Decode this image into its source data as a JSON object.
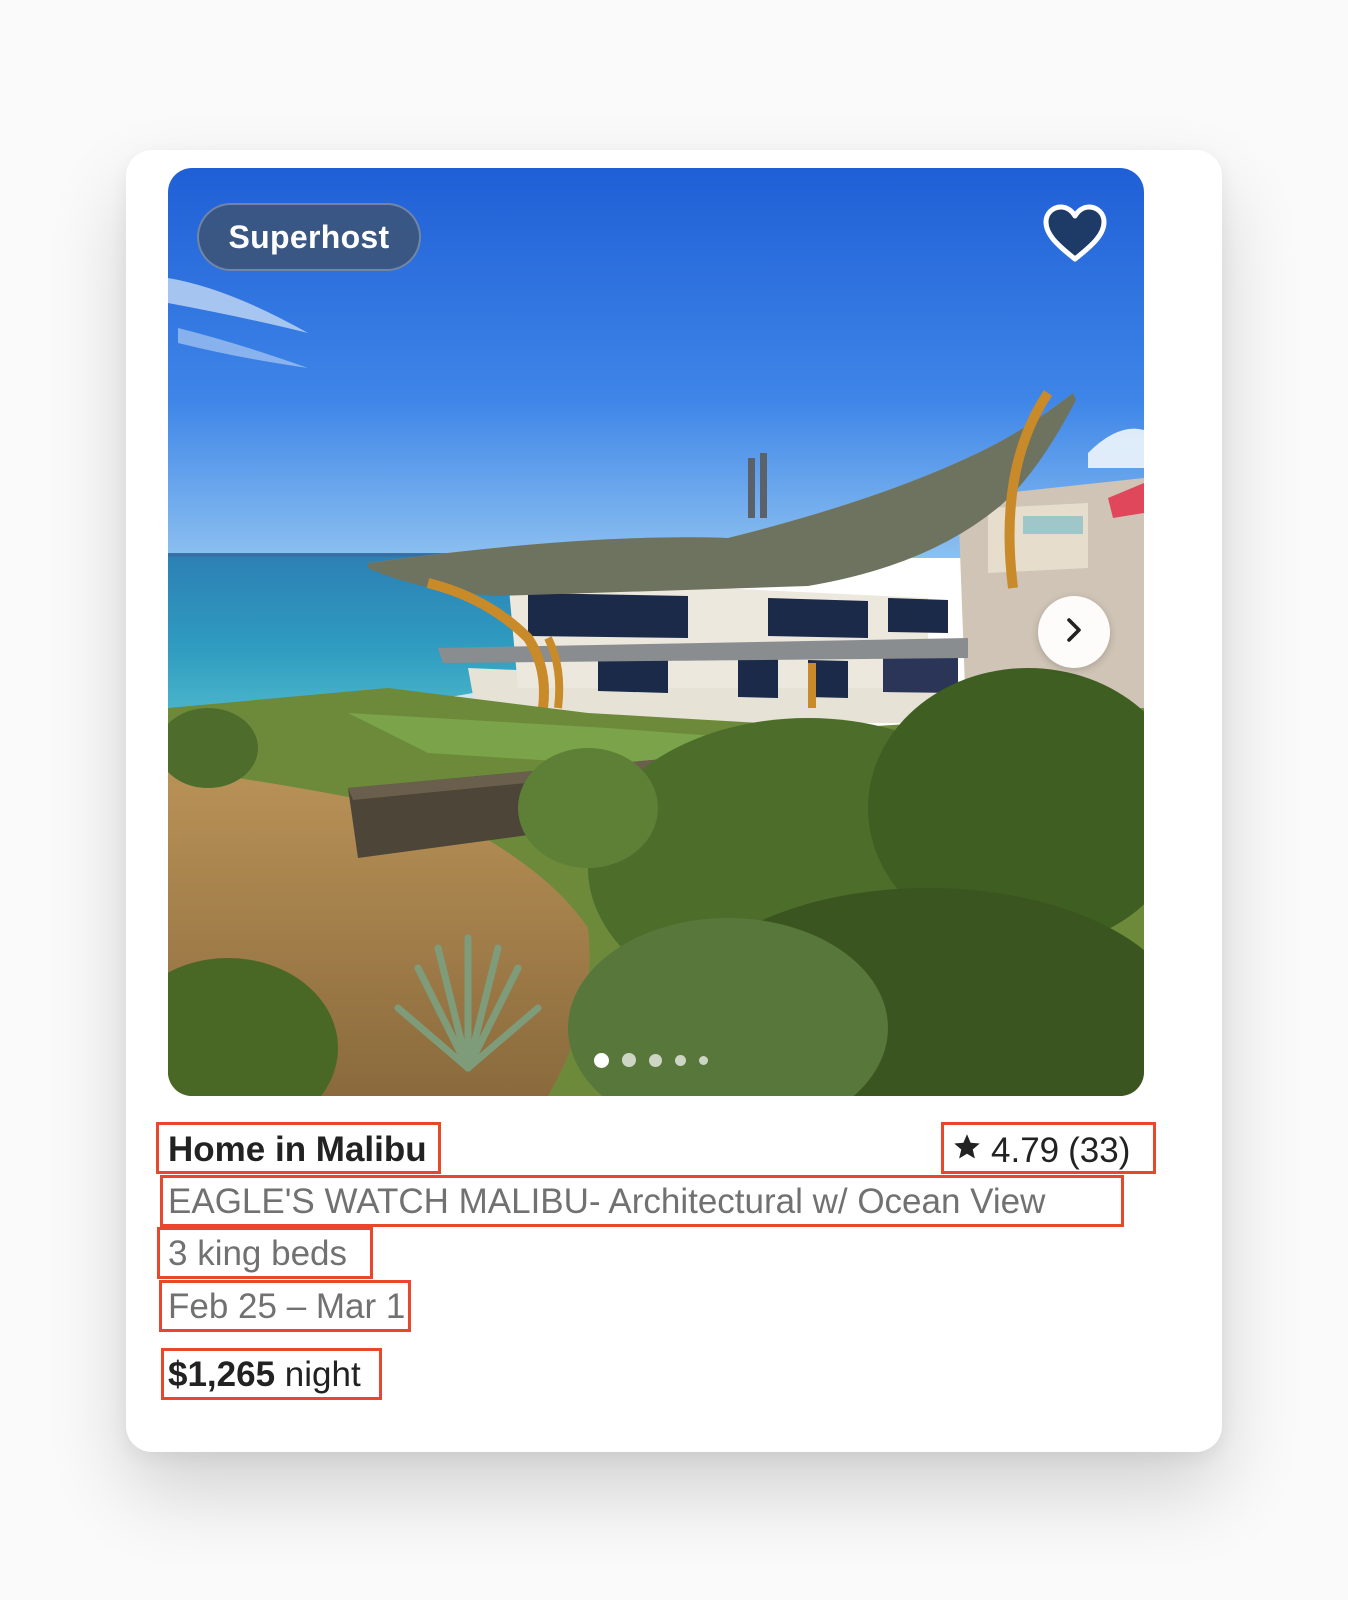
{
  "listing": {
    "badge": "Superhost",
    "title": "Home in Malibu",
    "rating": "4.79",
    "reviews": "(33)",
    "description": "EAGLE'S WATCH MALIBU- Architectural w/ Ocean View",
    "beds": "3 king beds",
    "dates": "Feb 25 – Mar 1",
    "price": "$1,265",
    "price_unit": "night"
  },
  "carousel": {
    "total_images": 5,
    "current_index": 1
  },
  "icons": {
    "wishlist": "heart-icon",
    "next": "chevron-right-icon",
    "rating": "star-icon"
  },
  "colors": {
    "highlight_box": "#e8472b",
    "primary_text": "#222222",
    "secondary_text": "#717171",
    "badge_bg": "#3c5478"
  }
}
